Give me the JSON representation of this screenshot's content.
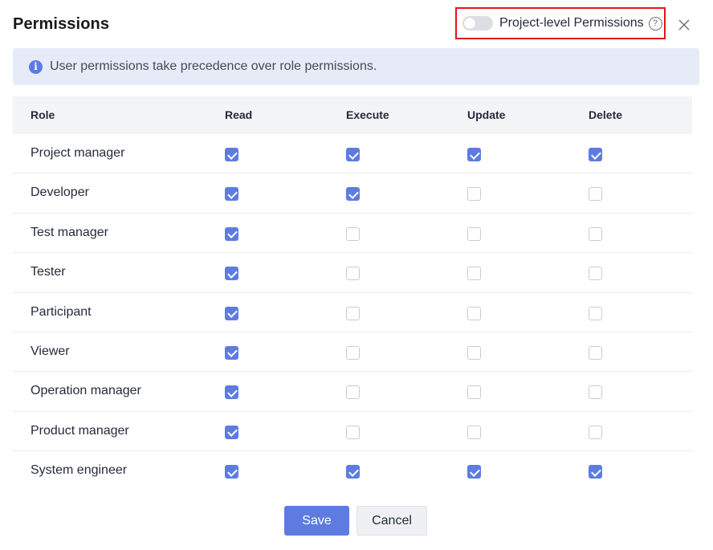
{
  "dialog": {
    "title": "Permissions",
    "project_level_toggle": {
      "label": "Project-level Permissions",
      "enabled": false,
      "help_icon": "question-circle-icon"
    },
    "close_icon": "close-icon"
  },
  "info": {
    "icon": "info-icon",
    "text": "User permissions take precedence over role permissions."
  },
  "table": {
    "columns": [
      "Role",
      "Read",
      "Execute",
      "Update",
      "Delete"
    ],
    "rows": [
      {
        "role": "Project manager",
        "read": true,
        "execute": true,
        "update": true,
        "delete": true
      },
      {
        "role": "Developer",
        "read": true,
        "execute": true,
        "update": false,
        "delete": false
      },
      {
        "role": "Test manager",
        "read": true,
        "execute": false,
        "update": false,
        "delete": false
      },
      {
        "role": "Tester",
        "read": true,
        "execute": false,
        "update": false,
        "delete": false
      },
      {
        "role": "Participant",
        "read": true,
        "execute": false,
        "update": false,
        "delete": false
      },
      {
        "role": "Viewer",
        "read": true,
        "execute": false,
        "update": false,
        "delete": false
      },
      {
        "role": "Operation manager",
        "read": true,
        "execute": false,
        "update": false,
        "delete": false
      },
      {
        "role": "Product manager",
        "read": true,
        "execute": false,
        "update": false,
        "delete": false
      },
      {
        "role": "System engineer",
        "read": true,
        "execute": true,
        "update": true,
        "delete": true
      }
    ]
  },
  "footer": {
    "save_label": "Save",
    "cancel_label": "Cancel"
  },
  "colors": {
    "primary": "#5e7ce0",
    "highlight_border": "#e2151c",
    "info_bg": "#e6ebf7"
  }
}
